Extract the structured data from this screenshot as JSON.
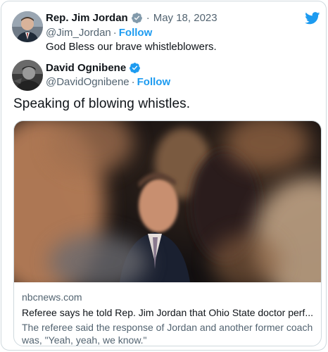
{
  "outer_tweet": {
    "name": "Rep. Jim Jordan",
    "verified_icon": "verified-badge-gray",
    "date": "May 18, 2023",
    "handle": "@Jim_Jordan",
    "follow_label": "Follow",
    "text": "God Bless our brave whistleblowers."
  },
  "quoted_tweet": {
    "name": "David Ognibene",
    "verified_icon": "verified-badge-blue",
    "handle": "@DavidOgnibene",
    "follow_label": "Follow",
    "text": "Speaking of blowing whistles."
  },
  "link_card": {
    "domain": "nbcnews.com",
    "title": "Referee says he told Rep. Jim Jordan that Ohio State doctor perf...",
    "description": "The referee said the response of Jordan and another former coach was, \"Yeah, yeah, we know.\""
  },
  "colors": {
    "accent": "#1d9bf0",
    "text": "#0f1419",
    "muted": "#536471",
    "border": "#cfd9de"
  },
  "icons": {
    "brand": "twitter-bird-icon"
  }
}
